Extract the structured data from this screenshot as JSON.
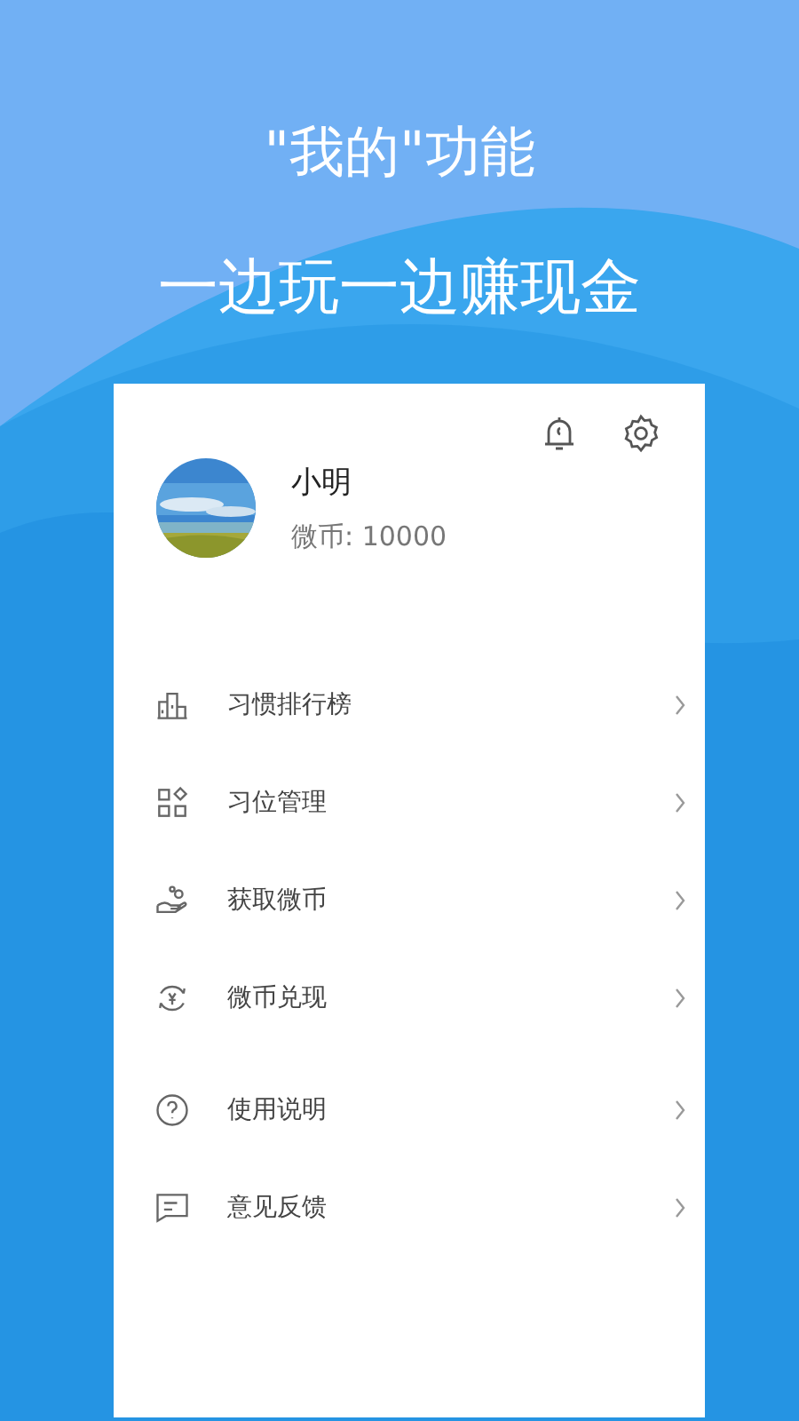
{
  "headline": "\"我的\"功能",
  "subheadline": "一边玩一边赚现金",
  "profile": {
    "name": "小明",
    "coins": "微币: 10000"
  },
  "menu_groups": [
    [
      {
        "label": "习惯排行榜"
      },
      {
        "label": "习位管理"
      },
      {
        "label": "获取微币"
      },
      {
        "label": "微币兑现"
      }
    ],
    [
      {
        "label": "使用说明"
      },
      {
        "label": "意见反馈"
      }
    ]
  ]
}
